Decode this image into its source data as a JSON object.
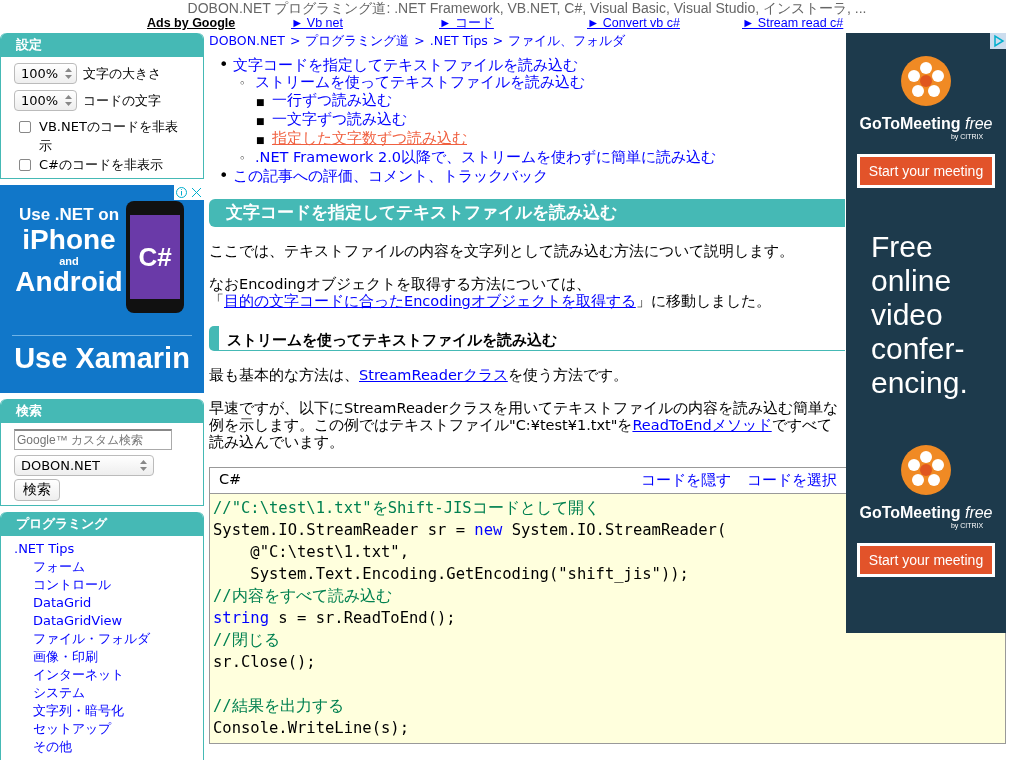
{
  "page_title": "DOBON.NET プログラミング道: .NET Framework, VB.NET, C#, Visual Basic, Visual Studio, インストーラ, ...",
  "ad_links": {
    "label": "Ads by Google",
    "links": [
      "► Vb net",
      "► コード",
      "► Convert vb c#",
      "► Stream read c#"
    ]
  },
  "sidebar": {
    "settings": {
      "title": "設定",
      "selects": [
        {
          "value": "100%",
          "label": "文字の大きさ"
        },
        {
          "value": "100%",
          "label": "コードの文字"
        }
      ],
      "checkboxes": [
        {
          "label": "VB.NETのコードを非表示",
          "checked": false
        },
        {
          "label": "C#のコードを非表示",
          "checked": false
        }
      ]
    },
    "ad": {
      "lines": [
        "Use .NET on",
        "iPhone",
        "and",
        "Android",
        "Use Xamarin"
      ],
      "screen_text": "C#"
    },
    "search": {
      "title": "検索",
      "placeholder": "Google™ カスタム検索",
      "scope": "DOBON.NET",
      "button": "検索"
    },
    "programming": {
      "title": "プログラミング",
      "items": [
        {
          "label": ".NET Tips",
          "children": [
            {
              "label": "フォーム"
            },
            {
              "label": "コントロール"
            },
            {
              "label": "DataGrid"
            },
            {
              "label": "DataGridView"
            },
            {
              "label": "ファイル・フォルダ"
            },
            {
              "label": "画像・印刷"
            },
            {
              "label": "インターネット"
            },
            {
              "label": "システム"
            },
            {
              "label": "文字列・暗号化"
            },
            {
              "label": "セットアップ"
            },
            {
              "label": "その他"
            }
          ]
        }
      ]
    }
  },
  "breadcrumb": [
    {
      "kind": "link",
      "text": "DOBON.NET"
    },
    {
      "kind": "separator",
      "text": ">"
    },
    {
      "kind": "link",
      "text": "プログラミング道"
    },
    {
      "kind": "separator",
      "text": ">"
    },
    {
      "kind": "link",
      "text": ".NET Tips"
    },
    {
      "kind": "separator",
      "text": ">"
    },
    {
      "kind": "link",
      "text": "ファイル、フォルダ"
    }
  ],
  "toc": [
    {
      "marker": "•",
      "label": "文字コードを指定してテキストファイルを読み込む",
      "selected": false,
      "children": [
        {
          "marker": "◦",
          "label": "ストリームを使ってテキストファイルを読み込む",
          "selected": false,
          "children": [
            {
              "marker": "■",
              "label": "一行ずつ読み込む",
              "selected": false
            },
            {
              "marker": "■",
              "label": "一文字ずつ読み込む",
              "selected": false
            },
            {
              "marker": "■",
              "label": "指定した文字数ずつ読み込む",
              "selected": true
            }
          ]
        },
        {
          "marker": "◦",
          "label": ".NET Framework 2.0以降で、ストリームを使わずに簡単に読み込む",
          "selected": false
        }
      ]
    },
    {
      "marker": "•",
      "label": "この記事への評価、コメント、トラックバック",
      "selected": false
    }
  ],
  "heading": "文字コードを指定してテキストファイルを読み込む",
  "intro": "ここでは、テキストファイルの内容を文字列として読み込む方法について説明します。",
  "note": {
    "before": "なおEncodingオブジェクトを取得する方法については、「",
    "link": "目的の文字コードに合ったEncodingオブジェクトを取得する",
    "after": "」に移動しました。"
  },
  "subheading": "ストリームを使ってテキストファイルを読み込む",
  "para1": {
    "before": "最も基本的な方法は、",
    "link": "StreamReaderクラス",
    "after": "を使う方法です。"
  },
  "para2": {
    "before": "早速ですが、以下にStreamReaderクラスを用いてテキストファイルの内容を読み込む簡単な例を示します。この例ではテキストファイル\"C:¥test¥1.txt\"を",
    "link": "ReadToEndメソッド",
    "after": "ですべて読み込んでいます。"
  },
  "code": {
    "language": "C#",
    "actions": [
      "コードを隠す",
      "コードを選択"
    ],
    "lines": [
      {
        "kind": "code",
        "segments": [
          {
            "kind": "comment",
            "text": "//\"C:\\test\\1.txt\"をShift-JISコードとして開く"
          }
        ]
      },
      {
        "kind": "code",
        "segments": [
          {
            "kind": "plain",
            "text": "System.IO.StreamReader sr = "
          },
          {
            "kind": "keyword",
            "text": "new"
          },
          {
            "kind": "plain",
            "text": " System.IO.StreamReader("
          }
        ]
      },
      {
        "kind": "code",
        "segments": [
          {
            "kind": "plain",
            "text": "    @\"C:\\test\\1.txt\","
          }
        ]
      },
      {
        "kind": "code",
        "segments": [
          {
            "kind": "plain",
            "text": "    System.Text.Encoding.GetEncoding(\"shift_jis\"));"
          }
        ]
      },
      {
        "kind": "code",
        "segments": [
          {
            "kind": "comment",
            "text": "//内容をすべて読み込む"
          }
        ]
      },
      {
        "kind": "code",
        "segments": [
          {
            "kind": "keyword",
            "text": "string"
          },
          {
            "kind": "plain",
            "text": " s = sr.ReadToEnd();"
          }
        ]
      },
      {
        "kind": "code",
        "segments": [
          {
            "kind": "comment",
            "text": "//閉じる"
          }
        ]
      },
      {
        "kind": "code",
        "segments": [
          {
            "kind": "plain",
            "text": "sr.Close();"
          }
        ]
      },
      {
        "kind": "blank"
      },
      {
        "kind": "code",
        "segments": [
          {
            "kind": "comment",
            "text": "//結果を出力する"
          }
        ]
      },
      {
        "kind": "code",
        "segments": [
          {
            "kind": "plain",
            "text": "Console.WriteLine(s);"
          }
        ]
      }
    ]
  },
  "right_ad": {
    "blocks": [
      {
        "brand": "GoToMeeting",
        "brand_suffix": "free",
        "by": "by CITRIX",
        "button": "Start your meeting"
      },
      {
        "brand": "GoToMeeting",
        "brand_suffix": "free",
        "by": "by CITRIX",
        "button": "Start your meeting"
      }
    ],
    "headline": [
      "Free",
      "online",
      "video",
      "confer-",
      "encing."
    ]
  }
}
